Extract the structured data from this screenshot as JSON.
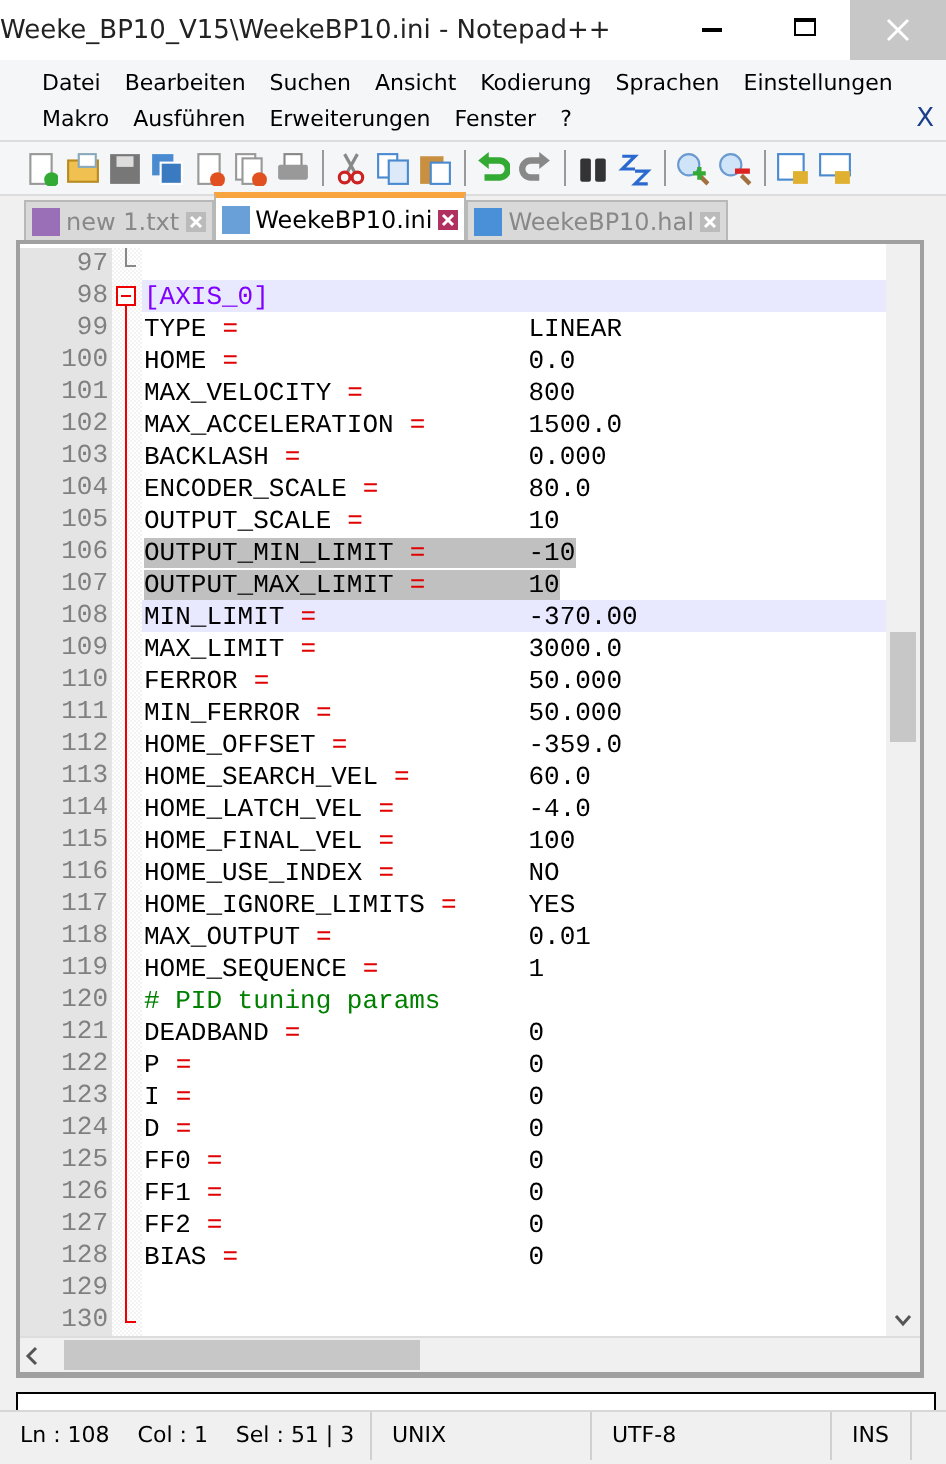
{
  "window": {
    "title": "Weeke_BP10_V15\\WeekeBP10.ini - Notepad++"
  },
  "menu_line_1": [
    "Datei",
    "Bearbeiten",
    "Suchen",
    "Ansicht",
    "Kodierung",
    "Sprachen",
    "Einstellungen"
  ],
  "menu_line_2": {
    "items": [
      "Makro",
      "Ausführen",
      "Erweiterungen",
      "Fenster",
      "?"
    ],
    "close": "X"
  },
  "toolbar": [
    {
      "kind": "new"
    },
    {
      "kind": "open"
    },
    {
      "kind": "save"
    },
    {
      "kind": "save-all"
    },
    {
      "kind": "close"
    },
    {
      "kind": "close-all"
    },
    {
      "kind": "print"
    },
    {
      "kind": "sep"
    },
    {
      "kind": "cut"
    },
    {
      "kind": "copy"
    },
    {
      "kind": "paste"
    },
    {
      "kind": "sep"
    },
    {
      "kind": "undo"
    },
    {
      "kind": "redo"
    },
    {
      "kind": "sep"
    },
    {
      "kind": "find"
    },
    {
      "kind": "replace"
    },
    {
      "kind": "sep"
    },
    {
      "kind": "zoom-in"
    },
    {
      "kind": "zoom-out"
    },
    {
      "kind": "sep"
    },
    {
      "kind": "sync-v"
    },
    {
      "kind": "sync-h"
    }
  ],
  "tabs": [
    {
      "label": "new  1.txt",
      "selected": false,
      "color": "#9b6fb8"
    },
    {
      "label": "WeekeBP10.ini",
      "selected": true,
      "color": "#6aa0d8"
    },
    {
      "label": "WeekeBP10.hal",
      "selected": false,
      "color": "#4a90d9"
    }
  ],
  "editor": {
    "lines": [
      {
        "num": "97",
        "kind": "blank",
        "selected": false,
        "current": false
      },
      {
        "num": "98",
        "kind": "section",
        "text": "[AXIS_0]",
        "selected": false,
        "current": true
      },
      {
        "num": "99",
        "kind": "pair",
        "key": "TYPE",
        "op": "=",
        "value": "LINEAR",
        "selected": false,
        "current": false
      },
      {
        "num": "100",
        "kind": "pair",
        "key": "HOME",
        "op": "=",
        "value": "0.0",
        "selected": false,
        "current": false
      },
      {
        "num": "101",
        "kind": "pair",
        "key": "MAX_VELOCITY",
        "op": "=",
        "value": "800",
        "selected": false,
        "current": false
      },
      {
        "num": "102",
        "kind": "pair",
        "key": "MAX_ACCELERATION",
        "op": "=",
        "value": "1500.0",
        "selected": false,
        "current": false
      },
      {
        "num": "103",
        "kind": "pair",
        "key": "BACKLASH",
        "op": "=",
        "value": "0.000",
        "selected": false,
        "current": false
      },
      {
        "num": "104",
        "kind": "pair",
        "key": "ENCODER_SCALE",
        "op": "=",
        "value": "80.0",
        "selected": false,
        "current": false
      },
      {
        "num": "105",
        "kind": "pair",
        "key": "OUTPUT_SCALE",
        "op": "=",
        "value": "10",
        "selected": false,
        "current": false
      },
      {
        "num": "106",
        "kind": "pair",
        "key": "OUTPUT_MIN_LIMIT",
        "op": "=",
        "value": "-10",
        "selected": true,
        "current": false
      },
      {
        "num": "107",
        "kind": "pair",
        "key": "OUTPUT_MAX_LIMIT",
        "op": "=",
        "value": "10",
        "selected": true,
        "current": false
      },
      {
        "num": "108",
        "kind": "pair",
        "key": "MIN_LIMIT",
        "op": "=",
        "value": "-370.00",
        "selected": false,
        "current": true
      },
      {
        "num": "109",
        "kind": "pair",
        "key": "MAX_LIMIT",
        "op": "=",
        "value": "3000.0",
        "selected": false,
        "current": false
      },
      {
        "num": "110",
        "kind": "pair",
        "key": "FERROR",
        "op": "=",
        "value": "50.000",
        "selected": false,
        "current": false
      },
      {
        "num": "111",
        "kind": "pair",
        "key": "MIN_FERROR",
        "op": "=",
        "value": "50.000",
        "selected": false,
        "current": false
      },
      {
        "num": "112",
        "kind": "pair",
        "key": "HOME_OFFSET",
        "op": "=",
        "value": "-359.0",
        "selected": false,
        "current": false
      },
      {
        "num": "113",
        "kind": "pair",
        "key": "HOME_SEARCH_VEL",
        "op": "=",
        "value": "60.0",
        "selected": false,
        "current": false
      },
      {
        "num": "114",
        "kind": "pair",
        "key": "HOME_LATCH_VEL",
        "op": "=",
        "value": "-4.0",
        "selected": false,
        "current": false
      },
      {
        "num": "115",
        "kind": "pair",
        "key": "HOME_FINAL_VEL",
        "op": "=",
        "value": "100",
        "selected": false,
        "current": false
      },
      {
        "num": "116",
        "kind": "pair",
        "key": "HOME_USE_INDEX",
        "op": "=",
        "value": "NO",
        "selected": false,
        "current": false
      },
      {
        "num": "117",
        "kind": "pair",
        "key": "HOME_IGNORE_LIMITS",
        "op": "=",
        "value": "YES",
        "selected": false,
        "current": false
      },
      {
        "num": "118",
        "kind": "pair",
        "key": "MAX_OUTPUT",
        "op": "=",
        "value": "0.01",
        "selected": false,
        "current": false
      },
      {
        "num": "119",
        "kind": "pair",
        "key": "HOME_SEQUENCE",
        "op": "=",
        "value": "1",
        "selected": false,
        "current": false
      },
      {
        "num": "120",
        "kind": "comment",
        "text": "# PID tuning params",
        "selected": false,
        "current": false
      },
      {
        "num": "121",
        "kind": "pair",
        "key": "DEADBAND",
        "op": "=",
        "value": "0",
        "selected": false,
        "current": false
      },
      {
        "num": "122",
        "kind": "pair",
        "key": "P",
        "op": "=",
        "value": "0",
        "selected": false,
        "current": false
      },
      {
        "num": "123",
        "kind": "pair",
        "key": "I",
        "op": "=",
        "value": "0",
        "selected": false,
        "current": false
      },
      {
        "num": "124",
        "kind": "pair",
        "key": "D",
        "op": "=",
        "value": "0",
        "selected": false,
        "current": false
      },
      {
        "num": "125",
        "kind": "pair",
        "key": "FF0",
        "op": "=",
        "value": "0",
        "selected": false,
        "current": false
      },
      {
        "num": "126",
        "kind": "pair",
        "key": "FF1",
        "op": "=",
        "value": "0",
        "selected": false,
        "current": false
      },
      {
        "num": "127",
        "kind": "pair",
        "key": "FF2",
        "op": "=",
        "value": "0",
        "selected": false,
        "current": false
      },
      {
        "num": "128",
        "kind": "pair",
        "key": "BIAS",
        "op": "=",
        "value": "0",
        "selected": false,
        "current": false
      },
      {
        "num": "129",
        "kind": "blank",
        "selected": false,
        "current": false
      },
      {
        "num": "130",
        "kind": "blank",
        "selected": false,
        "current": false
      }
    ]
  },
  "status_bar": {
    "position": "Ln : 108    Col : 1    Sel : 51 | 3",
    "eol": "UNIX",
    "encoding": "UTF-8",
    "mode": "INS"
  }
}
